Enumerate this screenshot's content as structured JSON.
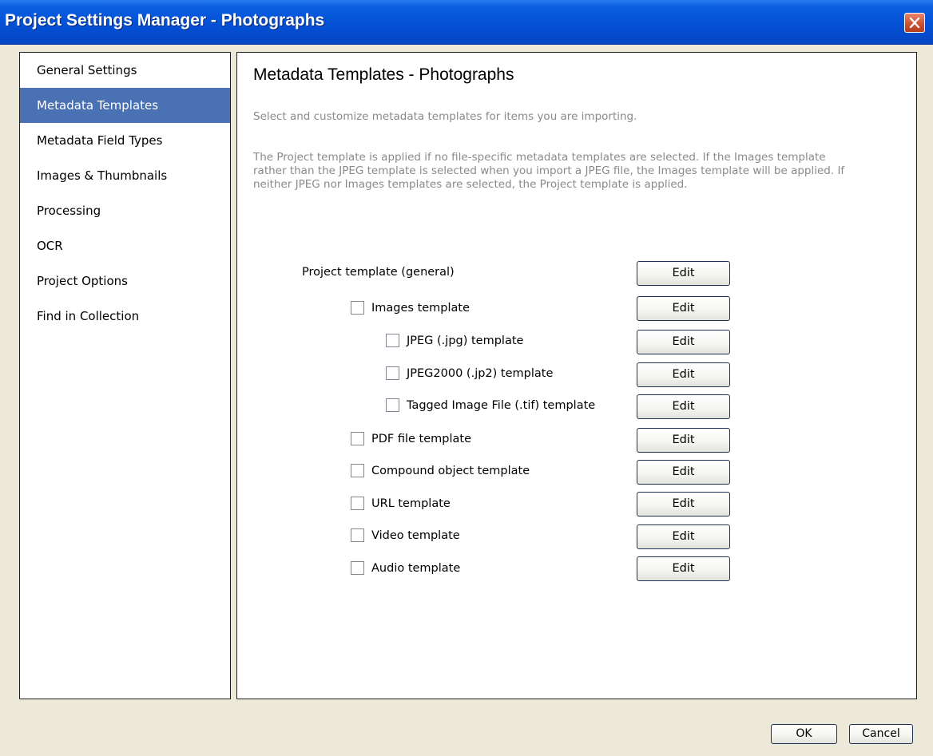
{
  "window": {
    "title": "Project Settings Manager - Photographs"
  },
  "nav": {
    "items": [
      {
        "label": "General Settings",
        "selected": false
      },
      {
        "label": "Metadata Templates",
        "selected": true
      },
      {
        "label": "Metadata Field Types",
        "selected": false
      },
      {
        "label": "Images & Thumbnails",
        "selected": false
      },
      {
        "label": "Processing",
        "selected": false
      },
      {
        "label": "OCR",
        "selected": false
      },
      {
        "label": "Project Options",
        "selected": false
      },
      {
        "label": "Find in Collection",
        "selected": false
      }
    ]
  },
  "content": {
    "heading": "Metadata Templates - Photographs",
    "subtitle": "Select and customize metadata templates for items you are importing.",
    "description": "The Project template is applied if no file-specific metadata templates are selected. If the Images template rather than the JPEG template is selected when you import a JPEG file, the Images template will be applied. If neither JPEG nor Images templates are selected, the Project template is applied.",
    "edit_label": "Edit",
    "templates": [
      {
        "label": "Project template (general)",
        "has_checkbox": false,
        "checked": false
      },
      {
        "label": "Images template",
        "has_checkbox": true,
        "checked": false
      },
      {
        "label": "JPEG (.jpg) template",
        "has_checkbox": true,
        "checked": false
      },
      {
        "label": "JPEG2000 (.jp2) template",
        "has_checkbox": true,
        "checked": false
      },
      {
        "label": "Tagged Image File (.tif) template",
        "has_checkbox": true,
        "checked": false
      },
      {
        "label": "PDF file template",
        "has_checkbox": true,
        "checked": false
      },
      {
        "label": "Compound object template",
        "has_checkbox": true,
        "checked": false
      },
      {
        "label": "URL template",
        "has_checkbox": true,
        "checked": false
      },
      {
        "label": "Video template",
        "has_checkbox": true,
        "checked": false
      },
      {
        "label": "Audio template",
        "has_checkbox": true,
        "checked": false
      }
    ]
  },
  "buttons": {
    "ok": "OK",
    "cancel": "Cancel"
  },
  "colors": {
    "titlebar": "#0451d6",
    "selected_nav": "#4a71b3",
    "close_button": "#c94f2d"
  }
}
